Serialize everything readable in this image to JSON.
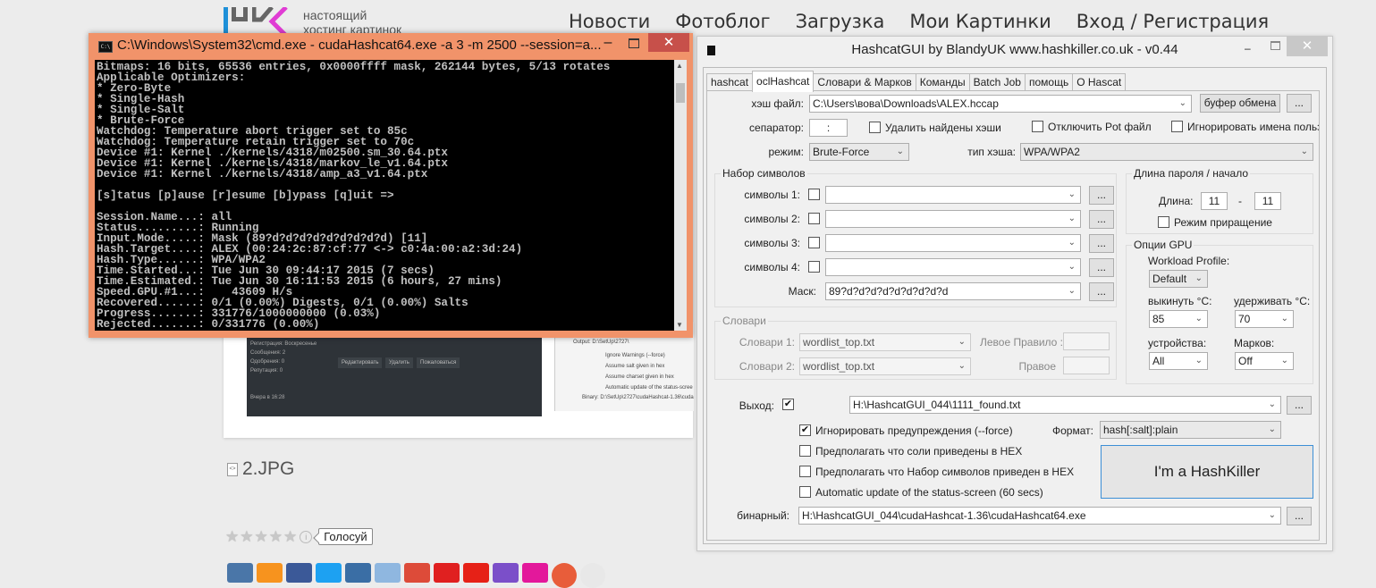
{
  "site": {
    "logo_tagline": [
      "настоящий",
      "хостинг картинок"
    ],
    "nav": [
      "Новости",
      "Фотоблог",
      "Загрузка",
      "Мои Картинки",
      "Вход / Регистрация"
    ],
    "preview": {
      "dark_rows": [
        "Регистрация:   Воскресенье",
        "Сообщения:   2",
        "Одобрения:   0",
        "Репутация:   0"
      ],
      "dark_buttons": [
        "Редактировать",
        "Удалить",
        "Пожаловаться"
      ],
      "dark_date": "Вчера в 16:28",
      "light_rows": [
        "Output:  D:\\SetUp\\2727\\",
        "Ignore Warnings (--force)",
        "Assume salt given in hex",
        "Assume charset given in hex",
        "Automatic update of the status-scree",
        "Binary:  D:\\SetUp\\2727\\cudaHashcat-1.36\\cuda"
      ]
    },
    "file_name": "2.JPG",
    "rating": {
      "stars_filled": 0,
      "stars_total": 5,
      "vote_label": "Голосуй"
    },
    "share_colors": [
      "#4a76a8",
      "#f7931e",
      "#3b5998",
      "#1da1f2",
      "#3a6ea5",
      "#8fb7e0",
      "#dd4b39",
      "#e02020",
      "#e62117",
      "#7b4fc9",
      "#e3189b",
      "#e85d3a",
      "#e8e8e8"
    ]
  },
  "cmd": {
    "title": "C:\\Windows\\System32\\cmd.exe - cudaHashcat64.exe  -a 3 -m 2500 --session=a...",
    "icon_text": "C:\\",
    "lines": [
      "Bitmaps: 16 bits, 65536 entries, 0x0000ffff mask, 262144 bytes, 5/13 rotates",
      "Applicable Optimizers:",
      "* Zero-Byte",
      "* Single-Hash",
      "* Single-Salt",
      "* Brute-Force",
      "Watchdog: Temperature abort trigger set to 85c",
      "Watchdog: Temperature retain trigger set to 70c",
      "Device #1: Kernel ./kernels/4318/m02500.sm_30.64.ptx",
      "Device #1: Kernel ./kernels/4318/markov_le_v1.64.ptx",
      "Device #1: Kernel ./kernels/4318/amp_a3_v1.64.ptx",
      "",
      "[s]tatus [p]ause [r]esume [b]ypass [q]uit =>",
      "",
      "Session.Name...: all",
      "Status.........: Running",
      "Input.Mode.....: Mask (89?d?d?d?d?d?d?d?d?d) [11]",
      "Hash.Target....: ALEX (00:24:2c:87:cf:77 <-> c0:4a:00:a2:3d:24)",
      "Hash.Type......: WPA/WPA2",
      "Time.Started...: Tue Jun 30 09:44:17 2015 (7 secs)",
      "Time.Estimated.: Tue Jun 30 16:11:53 2015 (6 hours, 27 mins)",
      "Speed.GPU.#1...:    43609 H/s",
      "Recovered......: 0/1 (0.00%) Digests, 0/1 (0.00%) Salts",
      "Progress.......: 331776/1000000000 (0.03%)",
      "Rejected.......: 0/331776 (0.00%)"
    ],
    "min_glyph": "–",
    "close_glyph": "✕"
  },
  "gui": {
    "title": "HashcatGUI by BlandyUK www.hashkiller.co.uk - v0.44",
    "tabs": [
      "hashcat",
      "oclHashcat",
      "Словари & Марков",
      "Команды",
      "Batch Job",
      "помощь",
      "О Hascat"
    ],
    "active_tab": "oclHashcat",
    "hash_file": {
      "label": "хэш файл:",
      "value": "C:\\Users\\вова\\Downloads\\ALEX.hccap",
      "clipboard_button": "буфер обмена",
      "browse": "..."
    },
    "separator": {
      "label": "сепаратор:",
      "value": ":"
    },
    "checks_top": [
      {
        "label": "Удалить найдены хэши",
        "checked": false
      },
      {
        "label": "Отключить Pot файл",
        "checked": false
      },
      {
        "label": "Игнорировать имена пользов",
        "checked": false
      }
    ],
    "mode": {
      "label": "режим:",
      "value": "Brute-Force"
    },
    "hash_type": {
      "label": "тип хэша:",
      "value": "WPA/WPA2"
    },
    "charset_group": {
      "title": "Набор символов",
      "rows": [
        {
          "label": "символы 1:",
          "checked": false,
          "value": ""
        },
        {
          "label": "символы 2:",
          "checked": false,
          "value": ""
        },
        {
          "label": "символы 3:",
          "checked": false,
          "value": ""
        },
        {
          "label": "символы 4:",
          "checked": false,
          "value": ""
        }
      ],
      "mask_label": "Маск:",
      "mask_value": "89?d?d?d?d?d?d?d?d?d",
      "browse": "..."
    },
    "length_group": {
      "title": "Длина пароля / начало",
      "length_label": "Длина:",
      "min": "11",
      "dash": "-",
      "max": "11",
      "increment_label": "Режим приращение",
      "increment_checked": false
    },
    "gpu_group": {
      "title": "Опции GPU",
      "workload_label": "Workload Profile:",
      "workload_value": "Default",
      "abort_label": "выкинуть °C:",
      "abort_value": "85",
      "retain_label": "удерживать °C:",
      "retain_value": "70",
      "devices_label": "устройства:",
      "devices_value": "All",
      "markov_label": "Марков:",
      "markov_value": "Off"
    },
    "dict_group": {
      "title": "Словари",
      "dict1_label": "Словари 1:",
      "dict1_value": "wordlist_top.txt",
      "dict2_label": "Словари 2:",
      "dict2_value": "wordlist_top.txt",
      "left_rule_label": "Левое Правило :",
      "right_rule_label": "Правое"
    },
    "output": {
      "label": "Выход:",
      "checked": true,
      "value": "H:\\HashcatGUI_044\\1111_found.txt",
      "browse": "..."
    },
    "options": [
      {
        "label": "Игнорировать предупреждения (--force)",
        "checked": true
      },
      {
        "label": "Предполагать что соли приведены в HEX",
        "checked": false
      },
      {
        "label": "Предполагать что Набор символов приведен в HEX",
        "checked": false
      },
      {
        "label": "Automatic update of the status-screen (60 secs)",
        "checked": false
      }
    ],
    "format": {
      "label": "Формат:",
      "value": "hash[:salt]:plain"
    },
    "run_button": "I'm a HashKiller",
    "binary": {
      "label": "бинарный:",
      "value": "H:\\HashcatGUI_044\\cudaHashcat-1.36\\cudaHashcat64.exe",
      "browse": "..."
    },
    "check_glyph": "✔",
    "arrow_glyph": "⌄",
    "close_glyph": "✕",
    "min_glyph": "–"
  }
}
